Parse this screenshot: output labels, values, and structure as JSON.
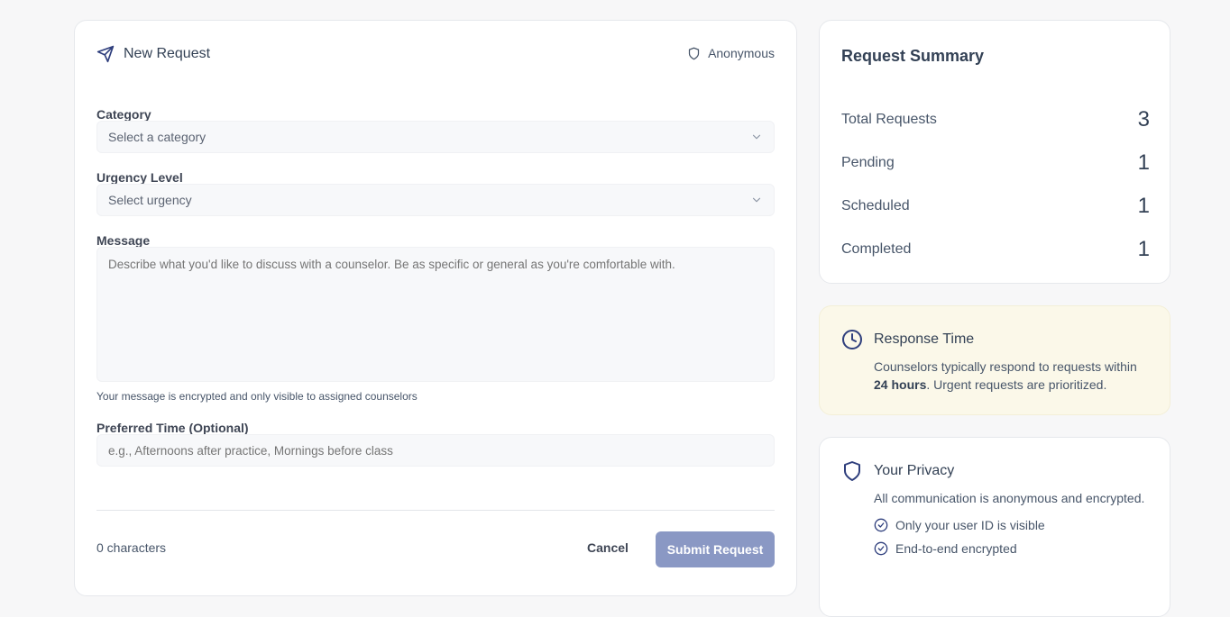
{
  "form": {
    "title": "New Request",
    "anonymous_label": "Anonymous",
    "category": {
      "label": "Category",
      "placeholder": "Select a category"
    },
    "urgency": {
      "label": "Urgency Level",
      "placeholder": "Select urgency"
    },
    "message": {
      "label": "Message",
      "placeholder": "Describe what you'd like to discuss with a counselor. Be as specific or general as you're comfortable with.",
      "hint": "Your message is encrypted and only visible to assigned counselors"
    },
    "preferred_time": {
      "label": "Preferred Time (Optional)",
      "placeholder": "e.g., Afternoons after practice, Mornings before class"
    },
    "char_count": "0 characters",
    "cancel_label": "Cancel",
    "submit_label": "Submit Request"
  },
  "summary": {
    "title": "Request Summary",
    "stats": [
      {
        "label": "Total Requests",
        "value": "3"
      },
      {
        "label": "Pending",
        "value": "1"
      },
      {
        "label": "Scheduled",
        "value": "1"
      },
      {
        "label": "Completed",
        "value": "1"
      }
    ]
  },
  "response_time": {
    "title": "Response Time",
    "text_before": "Counselors typically respond to requests within",
    "text_bold": "24 hours",
    "text_after": ". Urgent requests are prioritized."
  },
  "privacy": {
    "title": "Your Privacy",
    "description": "All communication is anonymous and encrypted.",
    "items": [
      "Only your user ID is visible",
      "End-to-end encrypted"
    ]
  },
  "icons": {
    "send": "send-icon",
    "shield": "shield-icon",
    "chevron": "chevron-down-icon",
    "clock": "clock-icon",
    "check": "check-circle-icon"
  },
  "colors": {
    "accent": "#2f3f7d",
    "submit_bg": "#8a98c4",
    "response_bg": "#fbf8e9"
  }
}
